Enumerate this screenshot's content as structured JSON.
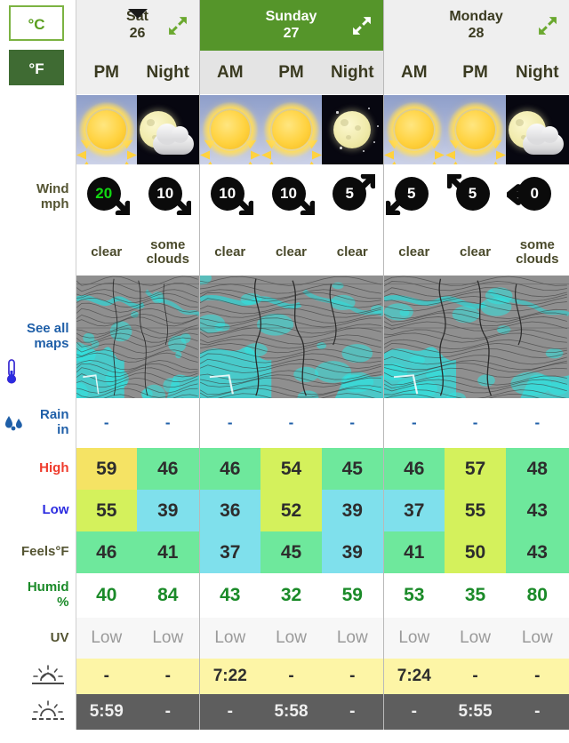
{
  "units": {
    "celsius_label": "°C",
    "fahrenheit_label": "°F",
    "selected": "°F"
  },
  "labels": {
    "wind": "Wind",
    "wind_unit": "mph",
    "see_all": "See all",
    "maps": "maps",
    "rain": "Rain",
    "rain_unit": "in",
    "high": "High",
    "low": "Low",
    "feels": "Feels°F",
    "humid": "Humid",
    "humid_unit": "%",
    "uv": "UV"
  },
  "days": [
    {
      "name": "Sat",
      "number": "26",
      "highlight": false,
      "active": true,
      "periods": [
        "PM",
        "Night"
      ]
    },
    {
      "name": "Sunday",
      "number": "27",
      "highlight": true,
      "active": false,
      "periods": [
        "AM",
        "PM",
        "Night"
      ]
    },
    {
      "name": "Monday",
      "number": "28",
      "highlight": false,
      "active": false,
      "periods": [
        "AM",
        "PM",
        "Night"
      ]
    }
  ],
  "columns": [
    {
      "day": 0,
      "period": "PM",
      "night": false,
      "icon": "sun-icon",
      "wind": "20",
      "wind_highlight": true,
      "wind_dir": "se",
      "condition": "clear",
      "rain": "-",
      "high": "59",
      "high_color": "#f5e364",
      "low": "55",
      "low_color": "#d4f15c",
      "feels": "46",
      "feels_color": "#6ee89c",
      "humidity": "40",
      "uv": "Low",
      "sunrise": "-",
      "sunset": "5:59"
    },
    {
      "day": 0,
      "period": "Night",
      "night": true,
      "icon": "moon-cloud-icon",
      "wind": "10",
      "wind_highlight": false,
      "wind_dir": "se",
      "condition": "some clouds",
      "rain": "-",
      "high": "46",
      "high_color": "#6ee89c",
      "low": "39",
      "low_color": "#7fe0ec",
      "feels": "41",
      "feels_color": "#6ee89c",
      "humidity": "84",
      "uv": "Low",
      "sunrise": "-",
      "sunset": "-"
    },
    {
      "day": 1,
      "period": "AM",
      "night": false,
      "icon": "sun-icon",
      "wind": "10",
      "wind_highlight": false,
      "wind_dir": "se",
      "condition": "clear",
      "rain": "-",
      "high": "46",
      "high_color": "#6ee89c",
      "low": "36",
      "low_color": "#7fe0ec",
      "feels": "37",
      "feels_color": "#7fe0ec",
      "humidity": "43",
      "uv": "Low",
      "sunrise": "7:22",
      "sunset": "-"
    },
    {
      "day": 1,
      "period": "PM",
      "night": false,
      "icon": "sun-icon",
      "wind": "10",
      "wind_highlight": false,
      "wind_dir": "se",
      "condition": "clear",
      "rain": "-",
      "high": "54",
      "high_color": "#d4f15c",
      "low": "52",
      "low_color": "#d4f15c",
      "feels": "45",
      "feels_color": "#6ee89c",
      "humidity": "32",
      "uv": "Low",
      "sunrise": "-",
      "sunset": "5:58"
    },
    {
      "day": 1,
      "period": "Night",
      "night": true,
      "icon": "moon-icon",
      "wind": "5",
      "wind_highlight": false,
      "wind_dir": "ne",
      "condition": "clear",
      "rain": "-",
      "high": "45",
      "high_color": "#6ee89c",
      "low": "39",
      "low_color": "#7fe0ec",
      "feels": "39",
      "feels_color": "#7fe0ec",
      "humidity": "59",
      "uv": "Low",
      "sunrise": "-",
      "sunset": "-"
    },
    {
      "day": 2,
      "period": "AM",
      "night": false,
      "icon": "sun-icon",
      "wind": "5",
      "wind_highlight": false,
      "wind_dir": "sw",
      "condition": "clear",
      "rain": "-",
      "high": "46",
      "high_color": "#6ee89c",
      "low": "37",
      "low_color": "#7fe0ec",
      "feels": "41",
      "feels_color": "#6ee89c",
      "humidity": "53",
      "uv": "Low",
      "sunrise": "7:24",
      "sunset": "-"
    },
    {
      "day": 2,
      "period": "PM",
      "night": false,
      "icon": "sun-icon",
      "wind": "5",
      "wind_highlight": false,
      "wind_dir": "nw",
      "condition": "clear",
      "rain": "-",
      "high": "57",
      "high_color": "#d4f15c",
      "low": "55",
      "low_color": "#d4f15c",
      "feels": "50",
      "feels_color": "#d4f15c",
      "humidity": "35",
      "uv": "Low",
      "sunrise": "-",
      "sunset": "5:55"
    },
    {
      "day": 2,
      "period": "Night",
      "night": true,
      "icon": "moon-cloud-icon",
      "wind": "0",
      "wind_highlight": false,
      "wind_dir": "w",
      "condition": "some clouds",
      "rain": "-",
      "high": "48",
      "high_color": "#6ee89c",
      "low": "43",
      "low_color": "#6ee89c",
      "feels": "43",
      "feels_color": "#6ee89c",
      "humidity": "80",
      "uv": "Low",
      "sunrise": "-",
      "sunset": "-"
    }
  ],
  "icons": {
    "expand": "expand-arrows-icon",
    "sunrise": "sunrise-icon",
    "sunset": "sunset-icon",
    "rain_drops": "rain-drops-icon",
    "thermo_high": "thermometer-high-icon",
    "thermo_low": "thermometer-low-icon"
  },
  "colors": {
    "green_header": "#55952a",
    "sunrise_bg": "#fdf5a6",
    "sunset_bg": "#5e5e5e",
    "humid_text": "#1a8a28",
    "high_text": "#ef3b2c",
    "low_text": "#2b2be0",
    "link_blue": "#1f5fa8",
    "wind_highlight": "#12d912"
  }
}
